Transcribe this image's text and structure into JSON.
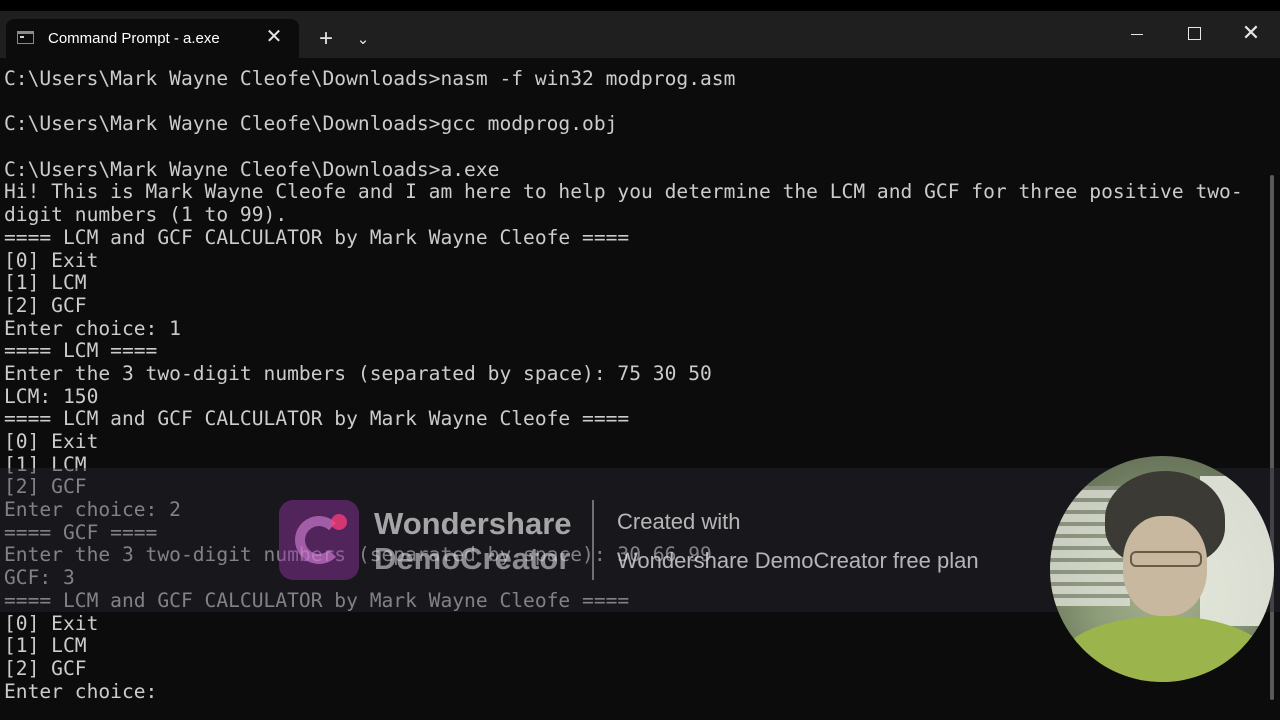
{
  "window": {
    "tab_title": "Command Prompt - a.exe",
    "tab_close_glyph": "✕",
    "new_tab_glyph": "+",
    "dropdown_glyph": "⌄",
    "close_glyph": "✕"
  },
  "terminal": {
    "lines": [
      "C:\\Users\\Mark Wayne Cleofe\\Downloads>nasm -f win32 modprog.asm",
      "",
      "C:\\Users\\Mark Wayne Cleofe\\Downloads>gcc modprog.obj",
      "",
      "C:\\Users\\Mark Wayne Cleofe\\Downloads>a.exe",
      "Hi! This is Mark Wayne Cleofe and I am here to help you determine the LCM and GCF for three positive two-",
      "digit numbers (1 to 99).",
      "==== LCM and GCF CALCULATOR by Mark Wayne Cleofe ====",
      "[0] Exit",
      "[1] LCM",
      "[2] GCF",
      "Enter choice: 1",
      "==== LCM ====",
      "Enter the 3 two-digit numbers (separated by space): 75 30 50",
      "LCM: 150",
      "==== LCM and GCF CALCULATOR by Mark Wayne Cleofe ====",
      "[0] Exit",
      "[1] LCM",
      "[2] GCF",
      "Enter choice: 2",
      "==== GCF ====",
      "Enter the 3 two-digit numbers (separated by space): 30 66 99",
      "GCF: 3",
      "==== LCM and GCF CALCULATOR by Mark Wayne Cleofe ====",
      "[0] Exit",
      "[1] LCM",
      "[2] GCF",
      "Enter choice: "
    ]
  },
  "watermark": {
    "brand_line1": "Wondershare",
    "brand_line2": "DemoCreator",
    "created_with": "Created with",
    "plan": "Wondershare DemoCreator free plan"
  },
  "colors": {
    "terminal_bg": "#0c0c0c",
    "terminal_text": "#cccccc",
    "titlebar_bg": "#1f1f1f"
  }
}
